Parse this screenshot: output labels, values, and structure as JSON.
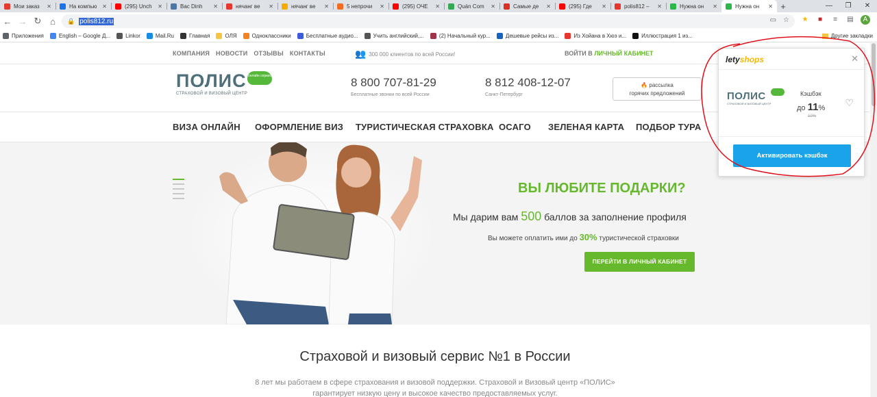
{
  "browser": {
    "tabs": [
      {
        "label": "Мои заказ",
        "color": "#e43c2f"
      },
      {
        "label": "На компью",
        "color": "#1a73e8"
      },
      {
        "label": "(295) Unch",
        "color": "#ff0000"
      },
      {
        "label": "Bac Dinh",
        "color": "#4a76a8"
      },
      {
        "label": "нячанг ве",
        "color": "#e8352e"
      },
      {
        "label": "нячанг ве",
        "color": "#f9ab00"
      },
      {
        "label": "5 непрочи",
        "color": "#f36c21"
      },
      {
        "label": "(295) ОЧЕ",
        "color": "#ff0000"
      },
      {
        "label": "Quán Com",
        "color": "#34a853"
      },
      {
        "label": "Самые де",
        "color": "#d93025"
      },
      {
        "label": "(295) Где ",
        "color": "#ff0000"
      },
      {
        "label": "polis812 –",
        "color": "#e8352e"
      },
      {
        "label": "Нужна он",
        "color": "#2db74a"
      },
      {
        "label": "Нужна он",
        "color": "#2db74a",
        "active": true
      }
    ],
    "new_tab": "+",
    "window_controls": [
      "—",
      "❐",
      "✕"
    ],
    "url": "polis812.ru",
    "bookmarks": [
      {
        "label": "Приложения",
        "color": "#5f6368"
      },
      {
        "label": "English – Google Д...",
        "color": "#4285f4"
      },
      {
        "label": "Linkor",
        "color": "#555555"
      },
      {
        "label": "Mail.Ru",
        "color": "#168de2"
      },
      {
        "label": "Главная",
        "color": "#333333"
      },
      {
        "label": "ОЛЯ",
        "color": "#f4c542"
      },
      {
        "label": "Одноклассники",
        "color": "#f58220"
      },
      {
        "label": "Бесплатные аудио...",
        "color": "#3b5bdb"
      },
      {
        "label": "Учить английский,...",
        "color": "#555555"
      },
      {
        "label": "(2) Начальный кур...",
        "color": "#a0324a"
      },
      {
        "label": "Дешевые рейсы из...",
        "color": "#1565c0"
      },
      {
        "label": "Из Хойана в Хюэ и...",
        "color": "#e8352e"
      },
      {
        "label": "Иллюстрация 1 из...",
        "color": "#111111"
      }
    ],
    "other_bookmarks": "Другие закладки",
    "avatar_letter": "A"
  },
  "site": {
    "topnav": [
      "КОМПАНИЯ",
      "НОВОСТИ",
      "ОТЗЫВЫ",
      "КОНТАКТЫ"
    ],
    "clients": "300 000 клиентов по всей России!",
    "login_prefix": "ВОЙТИ В",
    "login_accent": "ЛИЧНЫЙ КАБИНЕТ",
    "logo": "ПОЛИС",
    "logo_sub": "СТРАХОВОЙ И ВИЗОВЫЙ ЦЕНТР",
    "logo_badge": "онлайн сервис",
    "phone1": {
      "number": "8 800 707-81-29",
      "caption": "Бесплатные звонки по всей России"
    },
    "phone2": {
      "number": "8 812 408-12-07",
      "caption": "Санкт-Петербург"
    },
    "hot_line1": "рассылка",
    "hot_line2": "горячих предложений",
    "mainnav": [
      "ВИЗА ОНЛАЙН",
      "ОФОРМЛЕНИЕ ВИЗ",
      "ТУРИСТИЧЕСКАЯ СТРАХОВКА",
      "ОСАГО",
      "ЗЕЛЕНАЯ КАРТА",
      "ПОДБОР ТУРА"
    ],
    "hero": {
      "title": "ВЫ ЛЮБИТЕ ПОДАРКИ?",
      "line1_pre": "Мы дарим вам",
      "line1_num": "500",
      "line1_post": "баллов за заполнение профиля",
      "line2_pre": "Вы можете оплатить ими до",
      "line2_num": "30%",
      "line2_post": "туристической страховки",
      "button": "ПЕРЕЙТИ В ЛИЧНЫЙ КАБИНЕТ"
    },
    "section_title": "Страховой и визовый сервис №1 в России",
    "section_text_1": "8 лет мы работаем в сфере страхования и визовой поддержки. Страховой и Визовый центр «ПОЛИС»",
    "section_text_2": "гарантирует низкую цену и высокое качество предоставляемых услуг."
  },
  "popup": {
    "brand_a": "lety",
    "brand_b": "shops",
    "logo": "ПОЛИС",
    "logo_sub": "СТРАХОВОЙ И ВИЗОВЫЙ ЦЕНТР",
    "cashback_label": "Кэшбэк",
    "cashback_prefix": "до",
    "cashback_value": "11",
    "cashback_unit": "%",
    "cashback_old": "10%",
    "button": "Активировать кэшбэк"
  },
  "colors": {
    "accent": "#66b82c",
    "popup_button": "#1aa3e8",
    "annotation": "#e0101a"
  }
}
